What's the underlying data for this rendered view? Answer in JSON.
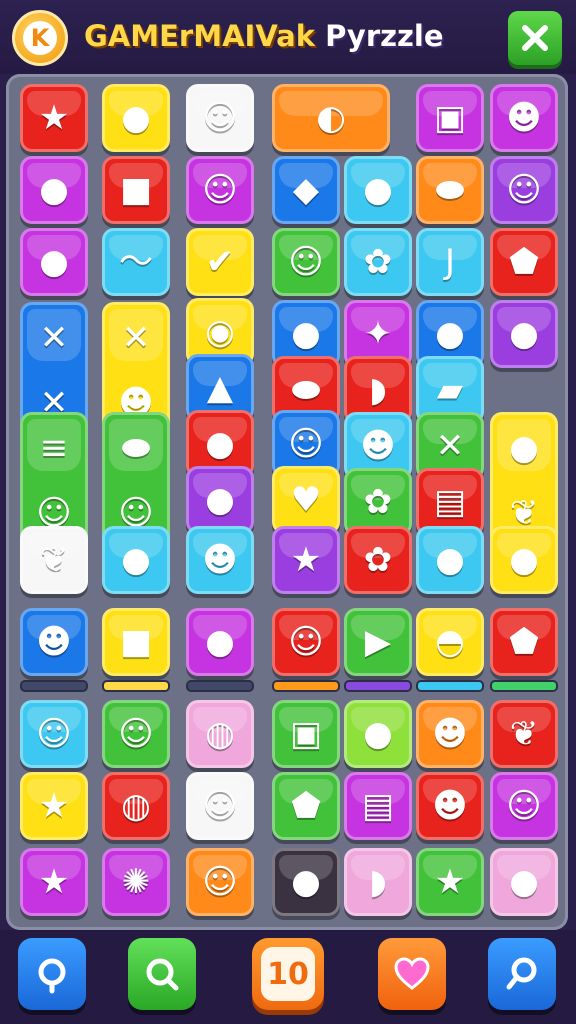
{
  "header": {
    "coin_letter": "K",
    "title_part1": "GAME",
    "title_part2": "rMAIVak",
    "title_part3": "Pyrzzle"
  },
  "colors": {
    "red": "#e8221c",
    "yellow": "#ffe015",
    "white": "#f7f7f7",
    "orange": "#ff8a1a",
    "magenta": "#c534e0",
    "purple": "#9b3ee0",
    "blue": "#1a78e8",
    "cyan": "#3cc8f0",
    "green": "#42c23a",
    "lime": "#8ee03a",
    "pink": "#f050c8",
    "lightpink": "#f0a8dc",
    "dark": "#3a3141"
  },
  "tiles": [
    {
      "icon": "star-face-icon",
      "glyph": "★"
    },
    {
      "icon": "fish-face-icon",
      "glyph": "●"
    },
    {
      "icon": "boy-face-icon",
      "glyph": "☺"
    },
    {
      "icon": "banana-corn-icon",
      "glyph": "◐"
    },
    {
      "icon": "robot-face-icon",
      "glyph": "▣"
    },
    {
      "icon": "frog-face-icon",
      "glyph": "☻"
    },
    {
      "icon": "apple-icon",
      "glyph": "●"
    },
    {
      "icon": "cup-icon",
      "glyph": "■"
    },
    {
      "icon": "boy-face-icon",
      "glyph": "☺"
    },
    {
      "icon": "cheese-icon",
      "glyph": "◆"
    },
    {
      "icon": "balloon-icon",
      "glyph": "●"
    },
    {
      "icon": "sausage-icon",
      "glyph": "⬬"
    },
    {
      "icon": "smiley-icon",
      "glyph": "☺"
    },
    {
      "icon": "ghost-face-icon",
      "glyph": "●"
    },
    {
      "icon": "feather-icon",
      "glyph": "〜"
    },
    {
      "icon": "checkmark-icon",
      "glyph": "✔"
    },
    {
      "icon": "boy-face-icon",
      "glyph": "☺"
    },
    {
      "icon": "flower-icon",
      "glyph": "✿"
    },
    {
      "icon": "hook-icon",
      "glyph": "J"
    },
    {
      "icon": "gem-icon",
      "glyph": "⬟"
    },
    {
      "icon": "leaf-cross-icon",
      "glyph": "✕"
    },
    {
      "icon": "monkey-face-icon",
      "glyph": "✕"
    },
    {
      "icon": "bow-icon",
      "glyph": "✕"
    },
    {
      "icon": "frog-face-icon",
      "glyph": "☻"
    },
    {
      "icon": "eye-icon",
      "glyph": "◉"
    },
    {
      "icon": "peach-icon",
      "glyph": "●"
    },
    {
      "icon": "grapes-icon",
      "glyph": "✦"
    },
    {
      "icon": "apple-bug-icon",
      "glyph": "●"
    },
    {
      "icon": "blue-face-icon",
      "glyph": "●"
    },
    {
      "icon": "thumb-icon",
      "glyph": "▲"
    },
    {
      "icon": "bread-icon",
      "glyph": "⬬"
    },
    {
      "icon": "shell-icon",
      "glyph": "◗"
    },
    {
      "icon": "gem-bar-icon",
      "glyph": "▰"
    },
    {
      "icon": "fish-burger-icon",
      "glyph": "≡"
    },
    {
      "icon": "cat-face-icon",
      "glyph": "☺"
    },
    {
      "icon": "pickle-icon",
      "glyph": "⬬"
    },
    {
      "icon": "pig-face-icon",
      "glyph": "☺"
    },
    {
      "icon": "blob-face-icon",
      "glyph": "●"
    },
    {
      "icon": "cat-face-icon",
      "glyph": "☺"
    },
    {
      "icon": "green-face-icon",
      "glyph": "☻"
    },
    {
      "icon": "smiley-x-icon",
      "glyph": "✕"
    },
    {
      "icon": "berry-face-icon",
      "glyph": "●"
    },
    {
      "icon": "leaf-icon",
      "glyph": "❦"
    },
    {
      "icon": "apple-icon",
      "glyph": "●"
    },
    {
      "icon": "heart-icon",
      "glyph": "♥"
    },
    {
      "icon": "flower-face-icon",
      "glyph": "✿"
    },
    {
      "icon": "notepad-icon",
      "glyph": "▤"
    },
    {
      "icon": "leaf-icon",
      "glyph": "❦"
    },
    {
      "icon": "blue-face-icon",
      "glyph": "●"
    },
    {
      "icon": "green-face-icon",
      "glyph": "☻"
    },
    {
      "icon": "star-icon",
      "glyph": "★"
    },
    {
      "icon": "lion-face-icon",
      "glyph": "✿"
    },
    {
      "icon": "tomato-icon",
      "glyph": "●"
    },
    {
      "icon": "balloon-icon",
      "glyph": "●"
    },
    {
      "icon": "devil-face-icon",
      "glyph": "☻"
    },
    {
      "icon": "folder-icon",
      "glyph": "■"
    },
    {
      "icon": "lollipop-icon",
      "glyph": "●"
    },
    {
      "icon": "jar-face-icon",
      "glyph": "☺"
    },
    {
      "icon": "play-icon",
      "glyph": "▶"
    },
    {
      "icon": "turtle-shell-icon",
      "glyph": "◓"
    },
    {
      "icon": "shield-icon",
      "glyph": "⬟"
    },
    {
      "icon": "cat-boy-face-icon",
      "glyph": "☺"
    },
    {
      "icon": "bear-face-icon",
      "glyph": "☺"
    },
    {
      "icon": "planet-icon",
      "glyph": "◍"
    },
    {
      "icon": "box-icon",
      "glyph": "▣"
    },
    {
      "icon": "strawberry-icon",
      "glyph": "●"
    },
    {
      "icon": "green-face-icon",
      "glyph": "☻"
    },
    {
      "icon": "leaf-icon",
      "glyph": "❦"
    },
    {
      "icon": "star-face-icon",
      "glyph": "★"
    },
    {
      "icon": "hot-air-balloon-icon",
      "glyph": "◍"
    },
    {
      "icon": "cat-face-icon",
      "glyph": "☺"
    },
    {
      "icon": "shield-face-icon",
      "glyph": "⬟"
    },
    {
      "icon": "sticky-note-icon",
      "glyph": "▤"
    },
    {
      "icon": "speech-face-icon",
      "glyph": "☻"
    },
    {
      "icon": "boy-face-icon",
      "glyph": "☺"
    },
    {
      "icon": "star-icon",
      "glyph": "★"
    },
    {
      "icon": "monster-icon",
      "glyph": "✺"
    },
    {
      "icon": "fox-face-icon",
      "glyph": "☺"
    },
    {
      "icon": "blue-face-icon",
      "glyph": "●"
    },
    {
      "icon": "fish-icon",
      "glyph": "◗"
    }
  ],
  "bars": [
    {
      "color": "#414868",
      "level": 0
    },
    {
      "color": "#ffd84a",
      "level": 1
    },
    {
      "color": "#414868",
      "level": 0
    },
    {
      "color": "#ff9a1a",
      "level": 1
    },
    {
      "color": "#8a4ae0",
      "level": 1
    },
    {
      "color": "#3cc8f0",
      "level": 1
    },
    {
      "color": "#42d06a",
      "level": 1
    }
  ],
  "bottom": {
    "moves": "10",
    "buttons": [
      {
        "icon": "pin-icon",
        "color": "#1a78e8"
      },
      {
        "icon": "search-icon",
        "color": "#42c23a"
      },
      {
        "icon": "heart-icon",
        "color": "#ff7a20"
      },
      {
        "icon": "magnifier-icon",
        "color": "#1a78e8"
      }
    ]
  }
}
